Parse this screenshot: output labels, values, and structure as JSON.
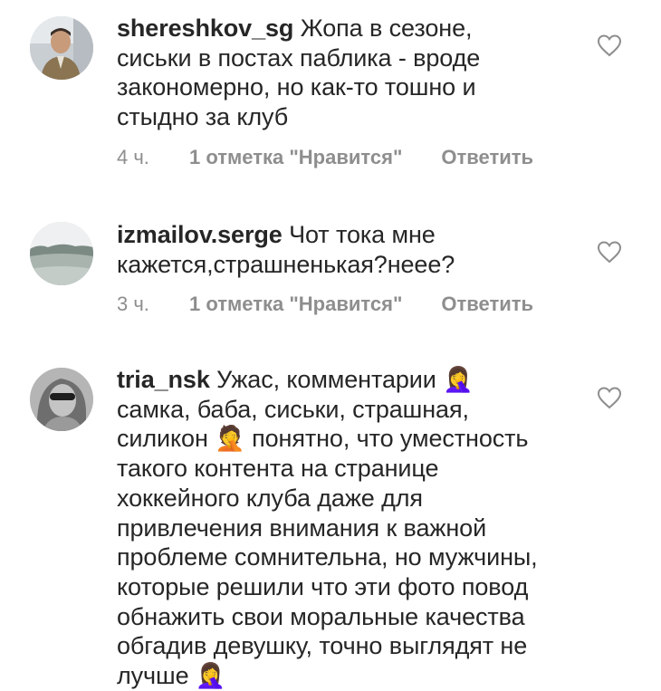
{
  "comments": [
    {
      "username": "shereshkov_sg",
      "text": "Жопа в сезоне, сиськи в постах паблика - вроде закономерно, но как-то тошно и стыдно за клуб",
      "time": "4 ч.",
      "likes": "1 отметка \"Нравится\"",
      "reply": "Ответить",
      "avatar_icon": "user-photo-man",
      "like_icon": "heart-outline-icon"
    },
    {
      "username": "izmailov.serge",
      "text": "Чот тока мне кажется,страшненькая?неее?",
      "time": "3 ч.",
      "likes": "1 отметка \"Нравится\"",
      "reply": "Ответить",
      "avatar_icon": "user-photo-landscape",
      "like_icon": "heart-outline-icon"
    },
    {
      "username": "tria_nsk",
      "text": "Ужас, комментарии 🤦‍♀ самка, баба, сиськи, страшная, силикон 🤦 понятно, что уместность такого контента на странице хоккейного клуба даже для привлечения внимания к важной проблеме сомнительна, но мужчины, которые решили что эти фото повод обнажить свои моральные качества обгадив девушку, точно выглядят не лучше 🤦‍♀",
      "avatar_icon": "user-photo-woman",
      "like_icon": "heart-outline-icon"
    }
  ],
  "colors": {
    "text": "#262626",
    "meta": "#8e8e8e",
    "icon": "#8e8e8e"
  }
}
